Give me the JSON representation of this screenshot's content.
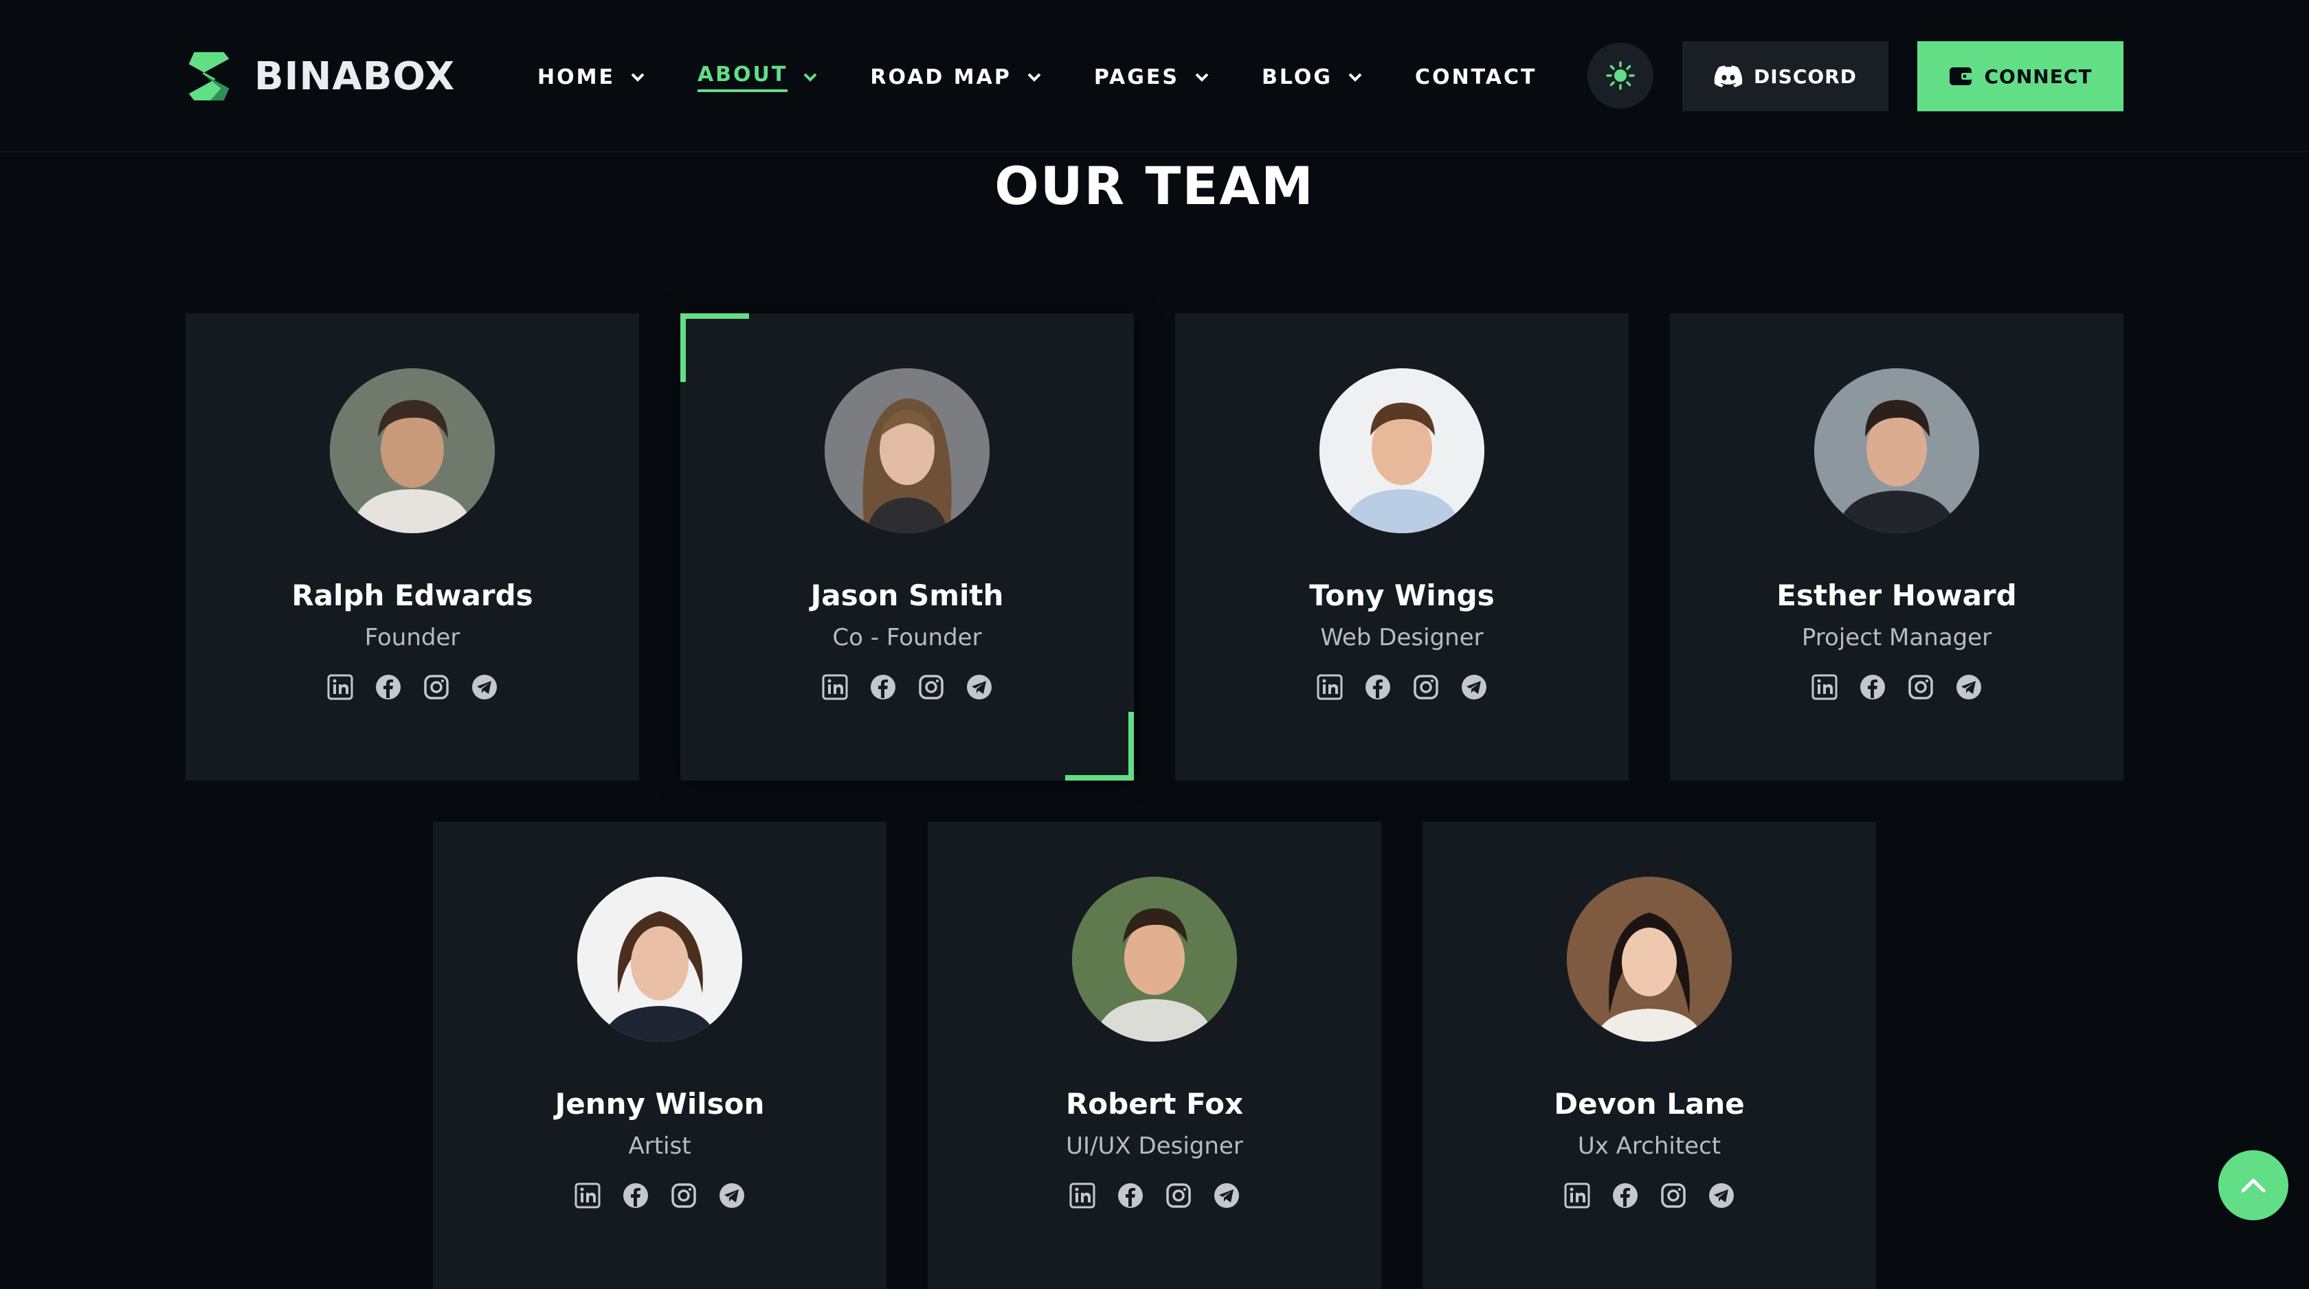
{
  "header": {
    "logo_text": "BINABOX",
    "nav": [
      {
        "label": "HOME",
        "has_dropdown": true,
        "active": false
      },
      {
        "label": "ABOUT",
        "has_dropdown": true,
        "active": true
      },
      {
        "label": "ROAD MAP",
        "has_dropdown": true,
        "active": false
      },
      {
        "label": "PAGES",
        "has_dropdown": true,
        "active": false
      },
      {
        "label": "BLOG",
        "has_dropdown": true,
        "active": false
      },
      {
        "label": "CONTACT",
        "has_dropdown": false,
        "active": false
      }
    ],
    "theme_toggle_icon": "sun-icon",
    "discord_label": "DISCORD",
    "connect_label": "CONNECT"
  },
  "section": {
    "title": "OUR TEAM"
  },
  "team": [
    {
      "name": "Ralph Edwards",
      "role": "Founder",
      "featured": false
    },
    {
      "name": "Jason Smith",
      "role": "Co - Founder",
      "featured": true
    },
    {
      "name": "Tony Wings",
      "role": "Web Designer",
      "featured": false
    },
    {
      "name": "Esther Howard",
      "role": "Project Manager",
      "featured": false
    },
    {
      "name": "Jenny Wilson",
      "role": "Artist",
      "featured": false
    },
    {
      "name": "Robert Fox",
      "role": "UI/UX Designer",
      "featured": false
    },
    {
      "name": "Devon Lane",
      "role": "Ux Architect",
      "featured": false
    }
  ],
  "social_icons": [
    "linkedin-icon",
    "facebook-icon",
    "instagram-icon",
    "telegram-icon"
  ],
  "colors": {
    "accent": "#62de87",
    "background": "#070b10",
    "card": "#141a20",
    "button_dark": "#1a1f26"
  }
}
